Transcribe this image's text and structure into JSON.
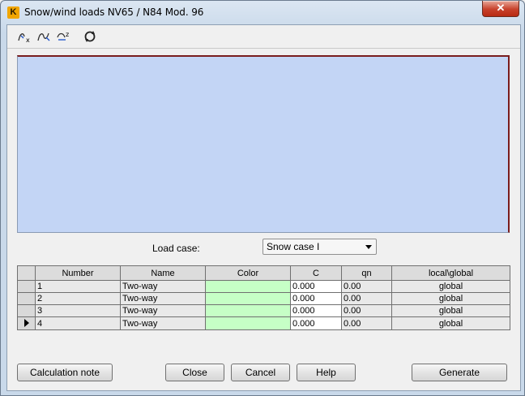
{
  "window": {
    "title": "Snow/wind loads  NV65 / N84 Mod. 96",
    "app_icon": "K",
    "close_glyph": "✕"
  },
  "toolbar": {
    "icons": [
      "param-x-icon",
      "curve-edit-icon",
      "zoom-z-icon",
      "refresh-icon"
    ]
  },
  "load_case": {
    "label": "Load case:",
    "value": "Snow case I"
  },
  "table": {
    "headers": [
      "Number",
      "Name",
      "Color",
      "C",
      "qn",
      "local\\global"
    ],
    "rows": [
      {
        "number": "1",
        "name": "Two-way",
        "color": "#c6ffc6",
        "c": "0.000",
        "qn": "0.00",
        "lg": "global"
      },
      {
        "number": "2",
        "name": "Two-way",
        "color": "#c6ffc6",
        "c": "0.000",
        "qn": "0.00",
        "lg": "global"
      },
      {
        "number": "3",
        "name": "Two-way",
        "color": "#c6ffc6",
        "c": "0.000",
        "qn": "0.00",
        "lg": "global"
      },
      {
        "number": "4",
        "name": "Two-way",
        "color": "#c6ffc6",
        "c": "0.000",
        "qn": "0.00",
        "lg": "global"
      }
    ],
    "current_row": 4
  },
  "buttons": {
    "calc_note": "Calculation note",
    "close": "Close",
    "cancel": "Cancel",
    "help": "Help",
    "generate": "Generate"
  }
}
